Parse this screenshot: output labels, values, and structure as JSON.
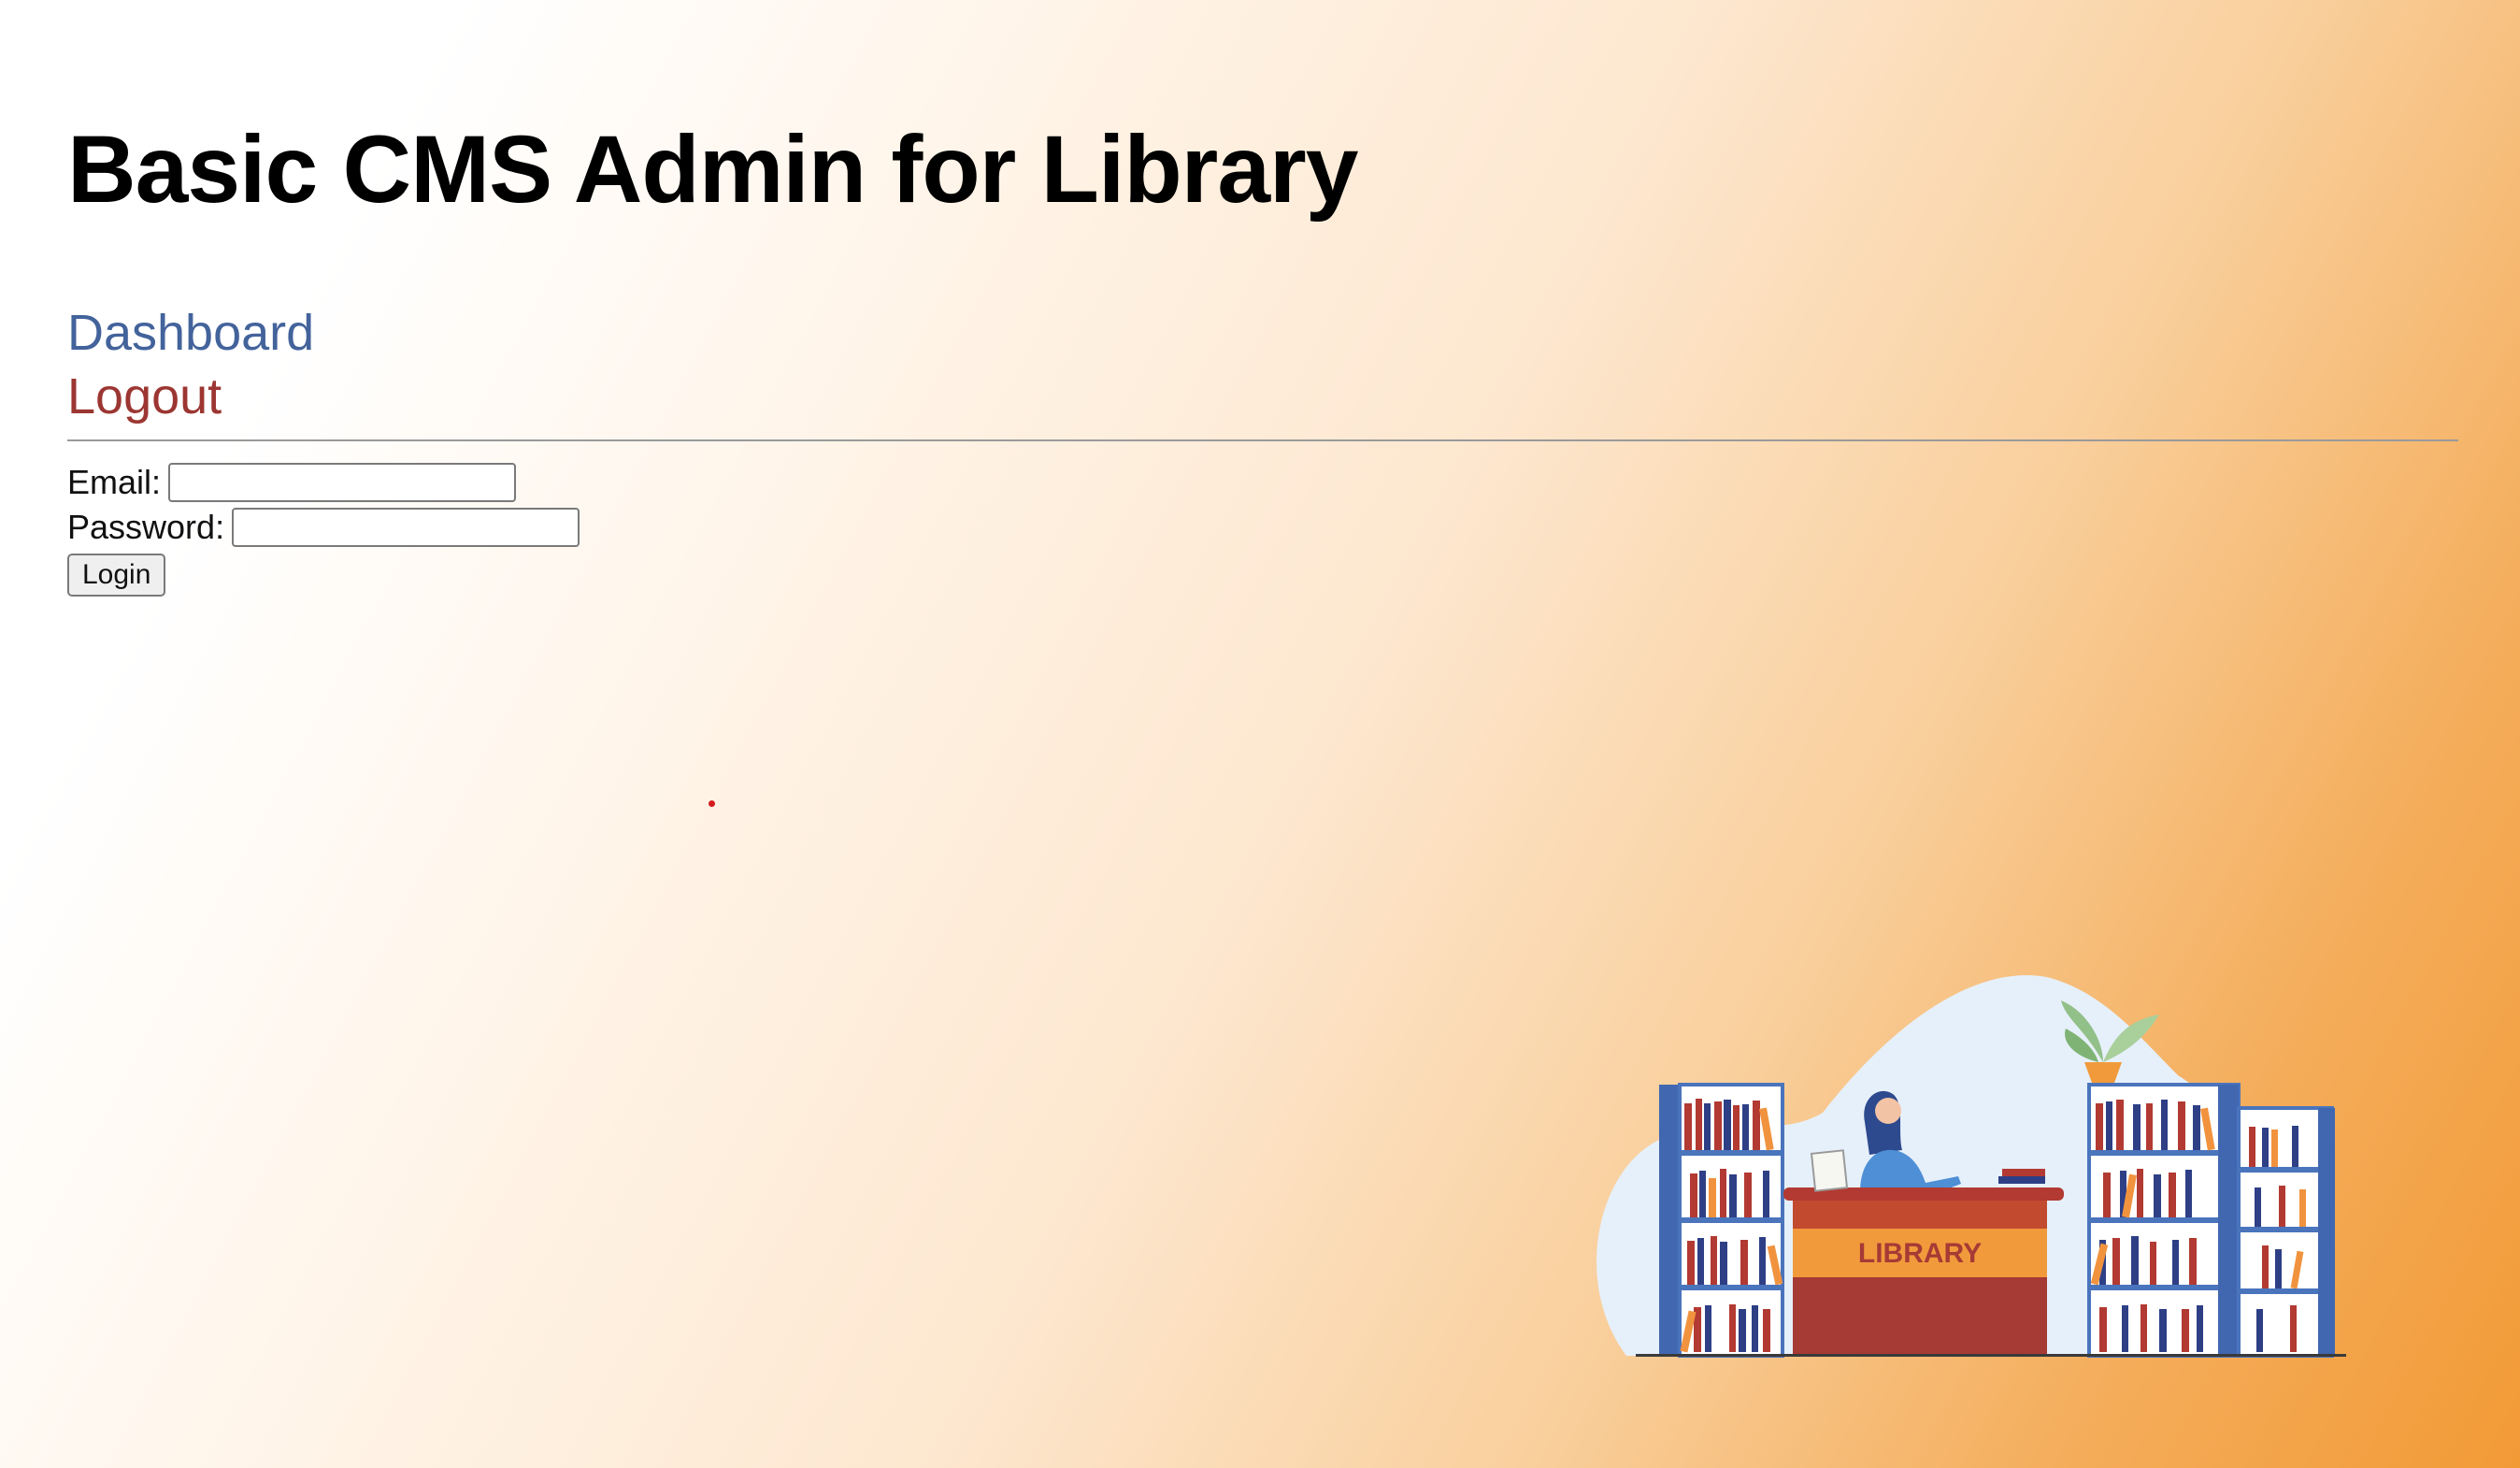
{
  "header": {
    "title": "Basic CMS Admin for Library"
  },
  "nav": {
    "dashboard_label": "Dashboard",
    "logout_label": "Logout"
  },
  "form": {
    "email_label": "Email:",
    "email_value": "",
    "password_label": "Password:",
    "password_value": "",
    "login_label": "Login"
  },
  "illustration": {
    "sign_text": "LIBRARY"
  },
  "colors": {
    "link": "#43639b",
    "logout": "#9c3632",
    "accent_orange": "#f29a36"
  }
}
